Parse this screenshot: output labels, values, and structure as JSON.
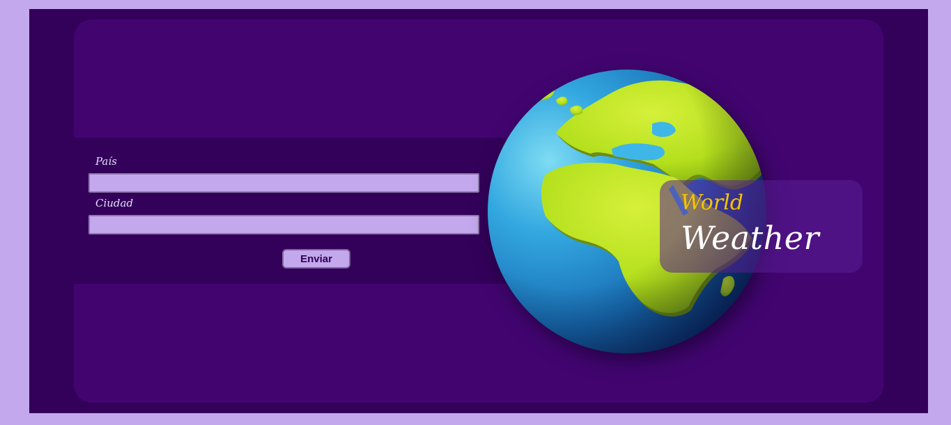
{
  "form": {
    "country_label": "País",
    "country_value": "",
    "city_label": "Ciudad",
    "city_value": "",
    "submit_label": "Enviar"
  },
  "title": {
    "line1": "World",
    "line2": "Weather"
  },
  "icons": {
    "globe": "earth-globe-icon"
  },
  "colors": {
    "page_border": "#c4a8ee",
    "background": "#33005a",
    "card": "#420570",
    "input_fill": "#c4a8ee",
    "title_accent": "#f5c400",
    "title_main": "#ffffff"
  }
}
